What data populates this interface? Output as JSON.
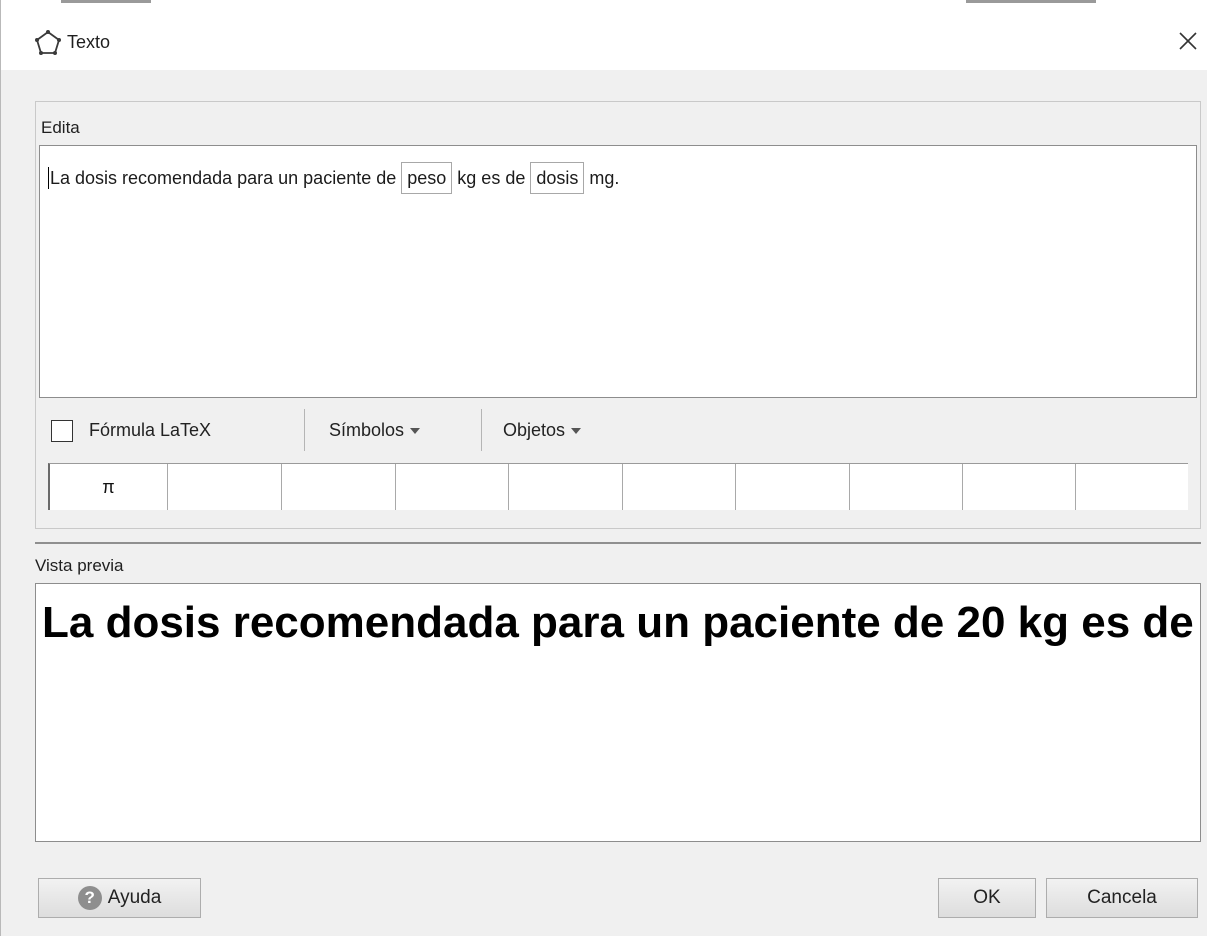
{
  "window": {
    "title": "Texto",
    "icon": "pentagon-outline-icon",
    "close_icon": "close-icon"
  },
  "edit": {
    "label": "Edita",
    "segments": [
      {
        "type": "text",
        "value": "La dosis recomendada para un paciente de"
      },
      {
        "type": "token",
        "value": "peso"
      },
      {
        "type": "text",
        "value": "kg es de"
      },
      {
        "type": "token",
        "value": "dosis"
      },
      {
        "type": "text",
        "value": "mg."
      }
    ]
  },
  "toolbar": {
    "latex_label": "Fórmula LaTeX",
    "latex_checked": false,
    "symbols_label": "Símbolos",
    "objects_label": "Objetos"
  },
  "symbols": [
    "π",
    "",
    "",
    "",
    "",
    "",
    "",
    "",
    "",
    ""
  ],
  "preview": {
    "label": "Vista previa",
    "text": "La dosis recomendada para un paciente de 20 kg es de"
  },
  "buttons": {
    "help": "Ayuda",
    "ok": "OK",
    "cancel": "Cancela"
  },
  "colors": {
    "window_bg": "#f0f0f0",
    "field_bg": "#ffffff",
    "border": "#8d8d8d"
  }
}
